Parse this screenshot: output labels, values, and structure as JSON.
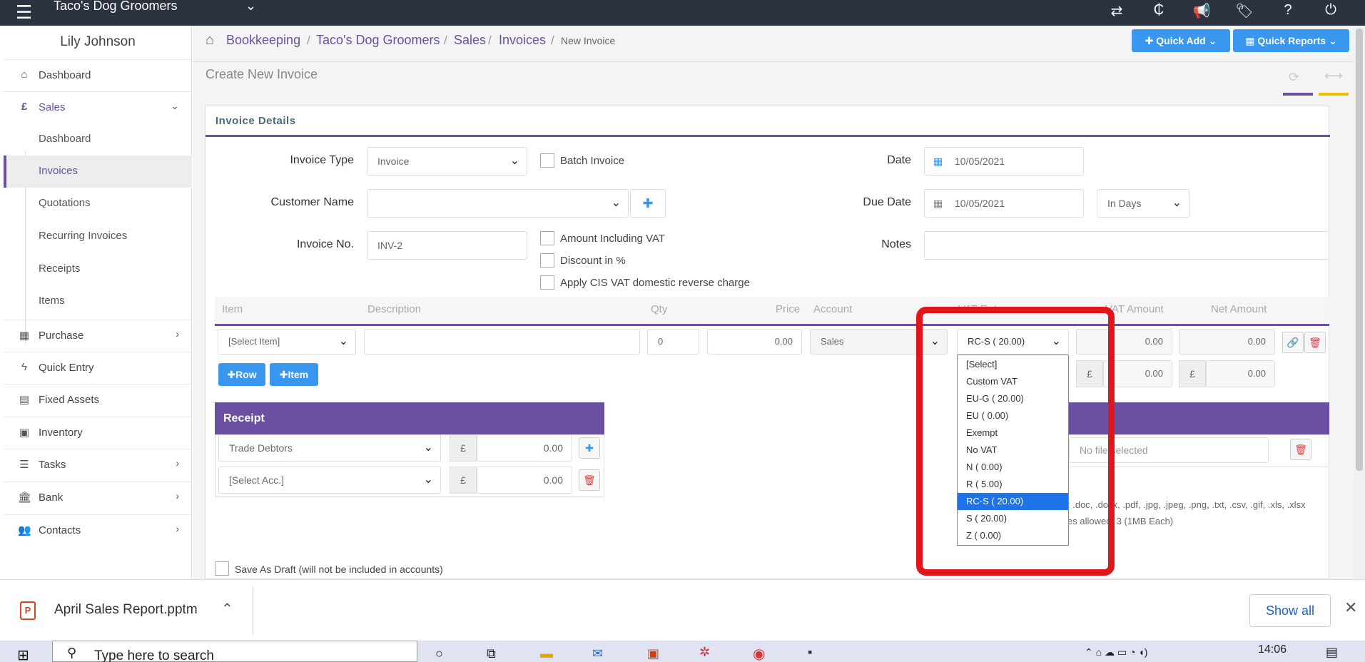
{
  "topbar": {
    "company": "Taco's Dog Groomers"
  },
  "sidebar": {
    "user": "Lily Johnson",
    "items": [
      {
        "label": "Dashboard"
      },
      {
        "label": "Sales"
      },
      {
        "label": "Purchase"
      },
      {
        "label": "Quick Entry"
      },
      {
        "label": "Fixed Assets"
      },
      {
        "label": "Inventory"
      },
      {
        "label": "Tasks"
      },
      {
        "label": "Bank"
      },
      {
        "label": "Contacts"
      }
    ],
    "sales_sub": [
      {
        "label": "Dashboard"
      },
      {
        "label": "Invoices"
      },
      {
        "label": "Quotations"
      },
      {
        "label": "Recurring Invoices"
      },
      {
        "label": "Receipts"
      },
      {
        "label": "Items"
      }
    ]
  },
  "breadcrumb": [
    "Bookkeeping",
    "Taco's Dog Groomers",
    "Sales",
    "Invoices",
    "New Invoice"
  ],
  "header_buttons": {
    "quick_add": "Quick Add",
    "quick_reports": "Quick Reports"
  },
  "page_title": "Create New Invoice",
  "invoice": {
    "panel_title": "Invoice Details",
    "invoice_type_label": "Invoice Type",
    "invoice_type_value": "Invoice",
    "batch_invoice": "Batch Invoice",
    "date_label": "Date",
    "date_value": "10/05/2021",
    "customer_label": "Customer Name",
    "due_date_label": "Due Date",
    "due_date_value": "10/05/2021",
    "due_type": "In Days",
    "invoice_no_label": "Invoice No.",
    "invoice_no_value": "INV-2",
    "amount_incl_vat": "Amount Including VAT",
    "discount_pct": "Discount in %",
    "cis_vat": "Apply CIS VAT domestic reverse charge",
    "notes_label": "Notes"
  },
  "table": {
    "headers": [
      "Item",
      "Description",
      "Qty",
      "Price",
      "Account",
      "VAT Rate",
      "VAT Amount",
      "Net Amount"
    ],
    "row": {
      "item": "[Select Item]",
      "qty": "0",
      "price": "0.00",
      "account": "Sales",
      "vat_rate": "RC-S ( 20.00)",
      "vat_amount": "0.00",
      "net_amount": "0.00"
    },
    "totals": {
      "currency": "£",
      "vat_total": "0.00",
      "net_total": "0.00"
    },
    "add_row": "Row",
    "add_item": "Item"
  },
  "vat_options": [
    "[Select]",
    "Custom VAT",
    "EU-G ( 20.00)",
    "EU ( 0.00)",
    "Exempt",
    "No VAT",
    "N ( 0.00)",
    "R ( 5.00)",
    "RC-S ( 20.00)",
    "S ( 20.00)",
    "Z ( 0.00)"
  ],
  "vat_selected_index": 8,
  "receipt": {
    "title": "Receipt",
    "rows": [
      {
        "account": "Trade Debtors",
        "currency": "£",
        "amount": "0.00"
      },
      {
        "account": "[Select Acc.]",
        "currency": "£",
        "amount": "0.00"
      }
    ]
  },
  "attachments": {
    "file_text": "No file selected",
    "allowed": ": .doc, .docx, .pdf, .jpg, .jpeg, .png, .txt, .csv, .gif, .xls, .xlsx",
    "limit": "es allowed: 3 (1MB Each)"
  },
  "draft": "Save As Draft (will not be included in accounts)",
  "downloads": {
    "file": "April Sales Report.pptm",
    "show_all": "Show all"
  },
  "taskbar": {
    "search": "Type here to search",
    "time": "14:06"
  },
  "colors": {
    "accent": "#6b4fa0",
    "primary": "#3a97f0",
    "highlight": "#e0161b",
    "topbar": "#2b3341"
  }
}
